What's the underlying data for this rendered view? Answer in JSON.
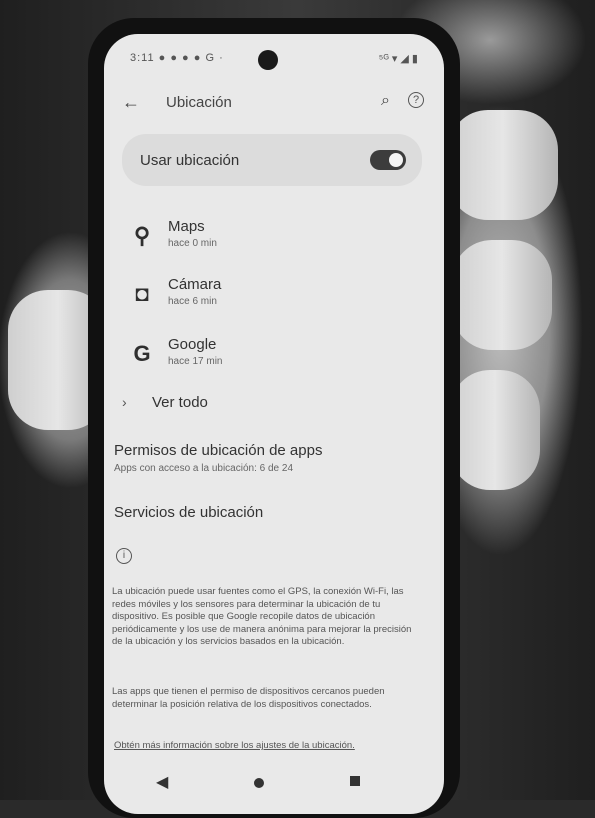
{
  "status_bar": {
    "time": "3:11",
    "icons_left": "● ● ● ● G ·",
    "icons_right": "⁵ᴳ ▾ ◢ ▮"
  },
  "app_bar": {
    "back_icon": "←",
    "title": "Ubicación",
    "search_icon": "⌕",
    "help_icon": "?"
  },
  "use_location": {
    "label": "Usar ubicación",
    "enabled": true
  },
  "recent_apps": [
    {
      "name": "Maps",
      "time": "hace 0 min",
      "icon": "location-pin-icon",
      "glyph": "⚲"
    },
    {
      "name": "Cámara",
      "time": "hace 6 min",
      "icon": "camera-icon",
      "glyph": "◘"
    },
    {
      "name": "Google",
      "time": "hace 17 min",
      "icon": "google-icon",
      "glyph": "G"
    }
  ],
  "see_all": {
    "chevron": "›",
    "label": "Ver todo"
  },
  "app_permissions": {
    "title": "Permisos de ubicación de apps",
    "subtitle": "Apps con acceso a la ubicación: 6 de 24"
  },
  "location_services": {
    "title": "Servicios de ubicación"
  },
  "info": {
    "icon": "i",
    "paragraph1": "La ubicación puede usar fuentes como el GPS, la conexión Wi-Fi, las redes móviles y los sensores para determinar la ubicación de tu dispositivo. Es posible que Google recopile datos de ubicación periódicamente y los use de manera anónima para mejorar la precisión de la ubicación y los servicios basados en la ubicación.",
    "paragraph2": "Las apps que tienen el permiso de dispositivos cercanos pueden determinar la posición relativa de los dispositivos conectados.",
    "link": "Obtén más información sobre los ajustes de la ubicación."
  },
  "nav_bar": {
    "back": "◀"
  }
}
